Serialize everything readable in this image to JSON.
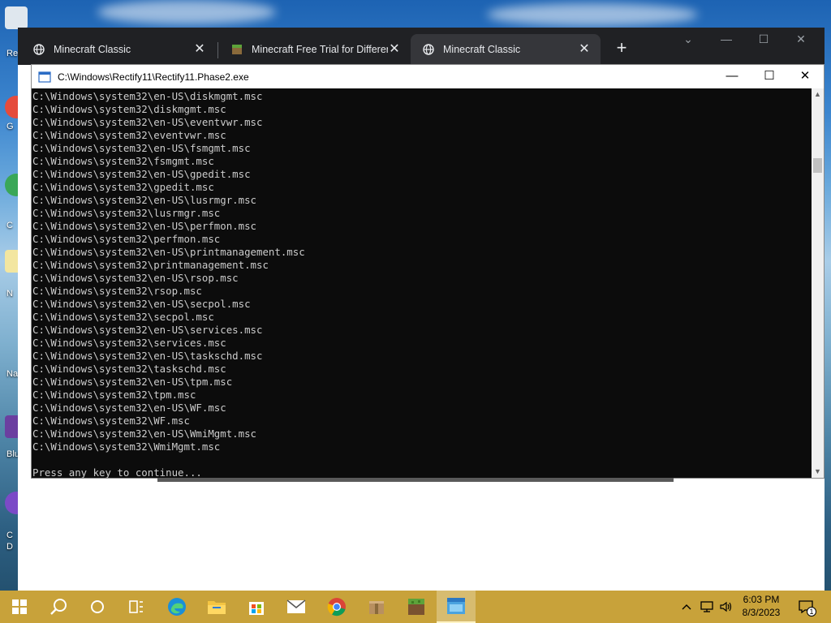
{
  "desktop": {
    "icon_labels": [
      "Re",
      "G",
      "C",
      "N",
      "Na",
      "Blu",
      "C",
      "D"
    ]
  },
  "browser": {
    "tabs": [
      {
        "title": "Minecraft Classic",
        "active": false,
        "favicon": "globe-icon"
      },
      {
        "title": "Minecraft Free Trial for Different",
        "active": false,
        "favicon": "minecraft-block-icon"
      },
      {
        "title": "Minecraft Classic",
        "active": true,
        "favicon": "globe-icon"
      }
    ],
    "new_tab_label": "+",
    "close_glyph": "✕"
  },
  "console": {
    "title": "C:\\Windows\\Rectify11\\Rectify11.Phase2.exe",
    "background": "#0c0c0c",
    "foreground": "#cccccc",
    "lines": [
      "C:\\Windows\\system32\\en-US\\diskmgmt.msc",
      "C:\\Windows\\system32\\diskmgmt.msc",
      "C:\\Windows\\system32\\en-US\\eventvwr.msc",
      "C:\\Windows\\system32\\eventvwr.msc",
      "C:\\Windows\\system32\\en-US\\fsmgmt.msc",
      "C:\\Windows\\system32\\fsmgmt.msc",
      "C:\\Windows\\system32\\en-US\\gpedit.msc",
      "C:\\Windows\\system32\\gpedit.msc",
      "C:\\Windows\\system32\\en-US\\lusrmgr.msc",
      "C:\\Windows\\system32\\lusrmgr.msc",
      "C:\\Windows\\system32\\en-US\\perfmon.msc",
      "C:\\Windows\\system32\\perfmon.msc",
      "C:\\Windows\\system32\\en-US\\printmanagement.msc",
      "C:\\Windows\\system32\\printmanagement.msc",
      "C:\\Windows\\system32\\en-US\\rsop.msc",
      "C:\\Windows\\system32\\rsop.msc",
      "C:\\Windows\\system32\\en-US\\secpol.msc",
      "C:\\Windows\\system32\\secpol.msc",
      "C:\\Windows\\system32\\en-US\\services.msc",
      "C:\\Windows\\system32\\services.msc",
      "C:\\Windows\\system32\\en-US\\taskschd.msc",
      "C:\\Windows\\system32\\taskschd.msc",
      "C:\\Windows\\system32\\en-US\\tpm.msc",
      "C:\\Windows\\system32\\tpm.msc",
      "C:\\Windows\\system32\\en-US\\WF.msc",
      "C:\\Windows\\system32\\WF.msc",
      "C:\\Windows\\system32\\en-US\\WmiMgmt.msc",
      "C:\\Windows\\system32\\WmiMgmt.msc",
      "",
      "Press any key to continue..."
    ]
  },
  "taskbar": {
    "background": "#c8a23a",
    "items": [
      "start-icon",
      "search-icon",
      "cortana-icon",
      "task-view-icon",
      "edge-icon",
      "file-explorer-icon",
      "store-icon",
      "mail-icon",
      "chrome-icon",
      "package-icon",
      "minecraft-icon",
      "rectify-icon"
    ],
    "active_item": "rectify-icon",
    "clock_time": "6:03 PM",
    "clock_date": "8/3/2023",
    "notification_count": "1"
  }
}
